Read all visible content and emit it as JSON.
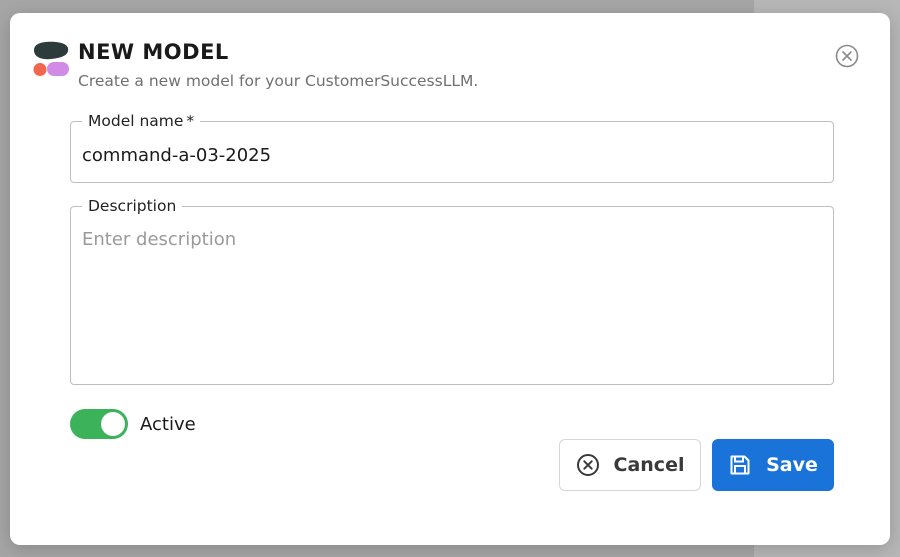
{
  "dialog": {
    "title": "NEW MODEL",
    "subtitle": "Create a new model for your CustomerSuccessLLM."
  },
  "form": {
    "model_name": {
      "label": "Model name",
      "required_marker": "*",
      "value": "command-a-03-2025"
    },
    "description": {
      "label": "Description",
      "placeholder": "Enter description",
      "value": ""
    },
    "active": {
      "label": "Active",
      "checked": true
    }
  },
  "actions": {
    "cancel_label": "Cancel",
    "save_label": "Save"
  },
  "colors": {
    "accent": "#1a73d9",
    "toggle_on": "#3cb35a",
    "logo_dark": "#2e3b3b",
    "logo_coral": "#f2684f",
    "logo_purple": "#d18be6"
  },
  "icons": {
    "logo": "app-logo-icon",
    "close": "close-circle-icon",
    "cancel": "x-circle-icon",
    "save": "floppy-disk-icon"
  }
}
